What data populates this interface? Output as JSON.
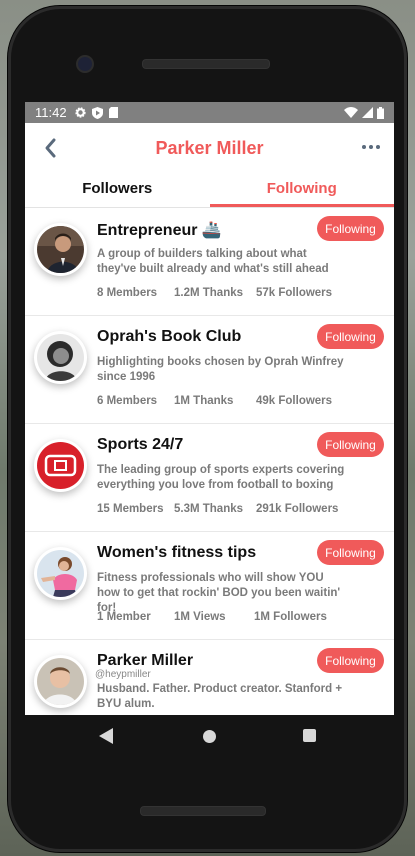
{
  "status": {
    "time": "11:42"
  },
  "header": {
    "title": "Parker Miller"
  },
  "tabs": [
    {
      "label": "Followers",
      "active": false
    },
    {
      "label": "Following",
      "active": true
    }
  ],
  "cards": [
    {
      "name": "Entrepreneur",
      "emoji": "🚢",
      "description": "A group of builders talking about what they've built already and what's still ahead",
      "stats": [
        "8 Members",
        "1.2M Thanks",
        "57k Followers"
      ],
      "button": "Following"
    },
    {
      "name": "Oprah's Book Club",
      "description": "Highlighting books chosen by Oprah Winfrey since 1996",
      "stats": [
        "6 Members",
        "1M Thanks",
        "49k Followers"
      ],
      "button": "Following"
    },
    {
      "name": "Sports 24/7",
      "description": "The leading group of sports experts covering everything you love from football to boxing",
      "stats": [
        "15 Members",
        "5.3M Thanks",
        "291k Followers"
      ],
      "button": "Following"
    },
    {
      "name": "Women's fitness tips",
      "description": "Fitness professionals who will show YOU how to get that rockin' BOD you been waitin' for!",
      "stats": [
        "1 Member",
        "1M Views",
        "1M Followers"
      ],
      "button": "Following"
    },
    {
      "name": "Parker Miller",
      "handle": "@heypmiller",
      "description": "Husband. Father. Product creator. Stanford + BYU alum.",
      "button": "Following"
    }
  ],
  "colors": {
    "accent": "#f05a5a",
    "statusbar": "#808080"
  }
}
